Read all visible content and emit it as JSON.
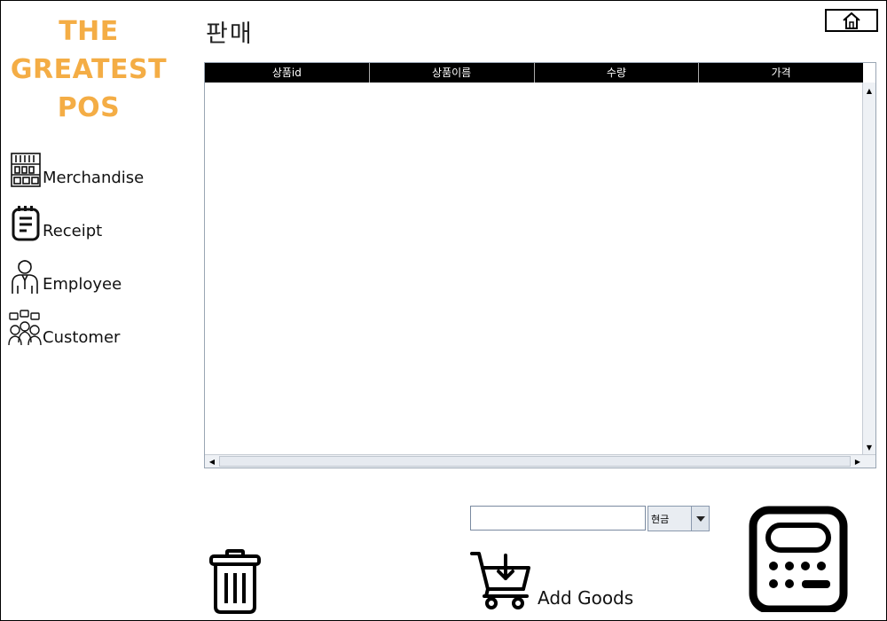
{
  "logo": {
    "line1": "THE",
    "line2": "GREATEST",
    "line3": "POS"
  },
  "sidebar": {
    "items": [
      {
        "label": "Merchandise",
        "icon": "shelf-icon"
      },
      {
        "label": "Receipt",
        "icon": "receipt-icon"
      },
      {
        "label": "Employee",
        "icon": "employee-icon"
      },
      {
        "label": "Customer",
        "icon": "customer-icon"
      }
    ]
  },
  "header": {
    "title": "판매",
    "home_icon": "home-icon"
  },
  "table": {
    "columns": [
      "상품id",
      "상품이름",
      "수량",
      "가격"
    ],
    "rows": []
  },
  "payment": {
    "amount_value": "",
    "method_selected": "현금"
  },
  "actions": {
    "delete_icon": "trash-icon",
    "add_goods_label": "Add Goods",
    "add_goods_icon": "cart-add-icon",
    "calculator_icon": "calculator-icon"
  },
  "colors": {
    "logo": "#f4ad45",
    "table_header": "#000000",
    "accent_border": "#7a8aa0"
  }
}
